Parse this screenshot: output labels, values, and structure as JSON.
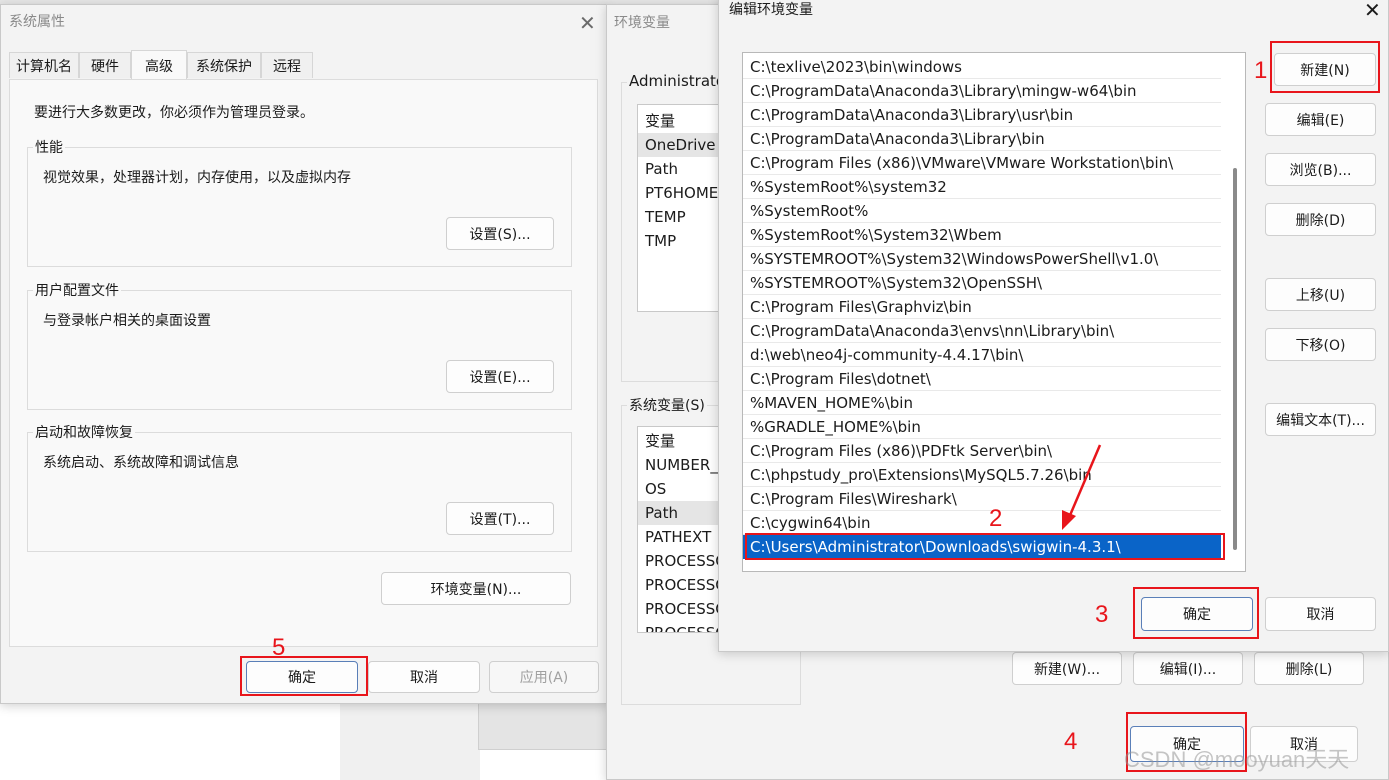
{
  "sysprops": {
    "title": "系统属性",
    "tabs": [
      "计算机名",
      "硬件",
      "高级",
      "系统保护",
      "远程"
    ],
    "admin_note": "要进行大多数更改，你必须作为管理员登录。",
    "perf": {
      "label": "性能",
      "desc": "视觉效果，处理器计划，内存使用，以及虚拟内存",
      "button": "设置(S)..."
    },
    "profile": {
      "label": "用户配置文件",
      "desc": "与登录帐户相关的桌面设置",
      "button": "设置(E)..."
    },
    "startup": {
      "label": "启动和故障恢复",
      "desc": "系统启动、系统故障和调试信息",
      "button": "设置(T)..."
    },
    "env_button": "环境变量(N)...",
    "ok": "确定",
    "cancel": "取消",
    "apply": "应用(A)"
  },
  "envvars": {
    "title": "环境变量",
    "user_section": "Administrato",
    "user_header": "变量",
    "user_vars": [
      "OneDrive",
      "Path",
      "PT6HOME",
      "TEMP",
      "TMP"
    ],
    "sys_section": "系统变量(S)",
    "sys_header": "变量",
    "sys_vars": [
      "NUMBER_C",
      "OS",
      "Path",
      "PATHEXT",
      "PROCESSO",
      "PROCESSO",
      "PROCESSO",
      "PROCESSO"
    ],
    "new": "新建(W)...",
    "edit": "编辑(I)...",
    "delete": "删除(L)",
    "ok": "确定",
    "cancel": "取消"
  },
  "editenv": {
    "title": "编辑环境变量",
    "paths": [
      "C:\\texlive\\2023\\bin\\windows",
      "C:\\ProgramData\\Anaconda3\\Library\\mingw-w64\\bin",
      "C:\\ProgramData\\Anaconda3\\Library\\usr\\bin",
      "C:\\ProgramData\\Anaconda3\\Library\\bin",
      "C:\\Program Files (x86)\\VMware\\VMware Workstation\\bin\\",
      "%SystemRoot%\\system32",
      "%SystemRoot%",
      "%SystemRoot%\\System32\\Wbem",
      "%SYSTEMROOT%\\System32\\WindowsPowerShell\\v1.0\\",
      "%SYSTEMROOT%\\System32\\OpenSSH\\",
      "C:\\Program Files\\Graphviz\\bin",
      "C:\\ProgramData\\Anaconda3\\envs\\nn\\Library\\bin\\",
      "d:\\web\\neo4j-community-4.4.17\\bin\\",
      "C:\\Program Files\\dotnet\\",
      "%MAVEN_HOME%\\bin",
      "%GRADLE_HOME%\\bin",
      "C:\\Program Files (x86)\\PDFtk Server\\bin\\",
      "C:\\phpstudy_pro\\Extensions\\MySQL5.7.26\\bin",
      "C:\\Program Files\\Wireshark\\",
      "C:\\cygwin64\\bin",
      "C:\\Users\\Administrator\\Downloads\\swigwin-4.3.1\\"
    ],
    "selected_index": 20,
    "buttons": {
      "new": "新建(N)",
      "edit": "编辑(E)",
      "browse": "浏览(B)...",
      "delete": "删除(D)",
      "up": "上移(U)",
      "down": "下移(O)",
      "edit_text": "编辑文本(T)..."
    },
    "ok": "确定",
    "cancel": "取消"
  },
  "annotations": {
    "step1": "1",
    "step2": "2",
    "step3": "3",
    "step4": "4",
    "step5": "5",
    "color": "#e8151b"
  },
  "watermark": "CSDN @mooyuan天天"
}
